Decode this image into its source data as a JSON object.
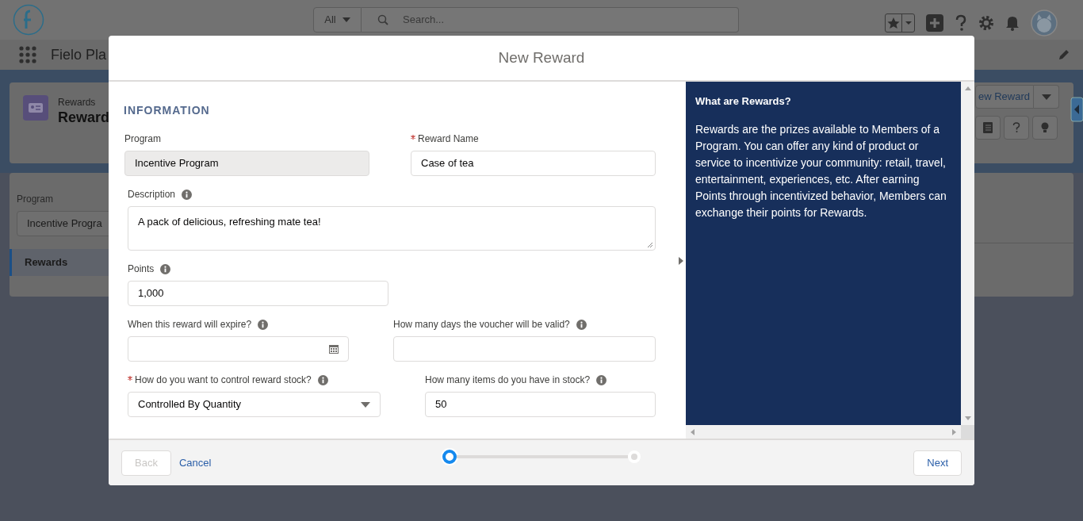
{
  "header": {
    "search_scope": "All",
    "search_placeholder": "Search..."
  },
  "nav": {
    "app_name": "Fielo Pla"
  },
  "page": {
    "object_label": "Rewards",
    "title": "Reward",
    "new_button": "ew Reward",
    "program_label": "Program",
    "program_value": "Incentive Progra",
    "tabs": [
      {
        "label": "Rewards",
        "selected": true
      }
    ]
  },
  "modal": {
    "title": "New Reward",
    "section_title": "INFORMATION",
    "rows": [
      [
        {
          "kind": "readonly",
          "label": "Program",
          "required": false,
          "info": false,
          "value": "Incentive Program"
        },
        {
          "kind": "text",
          "label": "Reward Name",
          "required": true,
          "info": false,
          "value": "Case of tea"
        }
      ],
      [
        {
          "kind": "textarea",
          "label": "Description",
          "required": false,
          "info": true,
          "value": "A pack of delicious, refreshing mate tea!"
        }
      ],
      [
        {
          "kind": "text",
          "label": "Points",
          "required": false,
          "info": true,
          "value": "1,000"
        }
      ],
      [
        {
          "kind": "date",
          "label": "When this reward will expire?",
          "required": false,
          "info": true
        },
        {
          "kind": "text",
          "label": "How many days the voucher will be valid?",
          "required": false,
          "info": true
        }
      ],
      [
        {
          "kind": "select",
          "label": "How do you want to control reward stock?",
          "required": true,
          "info": true,
          "value": "Controlled By Quantity"
        },
        {
          "kind": "text",
          "label": "How many items do you have in stock?",
          "required": false,
          "info": true,
          "value": "50"
        }
      ]
    ],
    "help": {
      "title": "What are Rewards?",
      "body": "Rewards are the prizes available to Members of a Program. You can offer any kind of product or service to incentivize your community: retail, travel, entertainment, experiences, etc. After earning Points through incentivized behavior, Members can exchange their points for Rewards."
    },
    "back": {
      "label": "Back",
      "disabled": true
    },
    "cancel": "Cancel",
    "next": "Next",
    "steps": [
      {
        "selected": true
      },
      {
        "selected": false
      }
    ]
  }
}
